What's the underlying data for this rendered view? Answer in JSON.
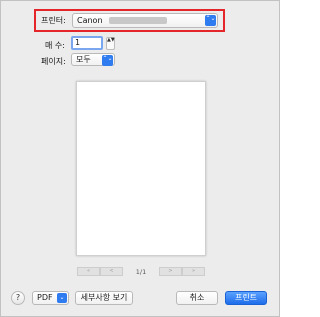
{
  "printer": {
    "label": "프린터:",
    "value": "Canon",
    "arrows_icon": "⌃⌄"
  },
  "copies": {
    "label": "매 수:",
    "value": "1",
    "stepper_icon": "▲▼"
  },
  "pages": {
    "label": "페이지:",
    "value": "모두",
    "arrows_icon": "⌃⌄"
  },
  "preview": {
    "first_icon": "«",
    "prev_icon": "<",
    "page_indicator": "1/1",
    "next_icon": ">",
    "last_icon": "»"
  },
  "footer": {
    "help_label": "?",
    "pdf_label": "PDF",
    "pdf_arrow": "⌄",
    "details_label": "세부사항 보기",
    "cancel_label": "취소",
    "print_label": "프린트"
  },
  "colors": {
    "highlight": "#e4262b",
    "accent": "#2f7bf0"
  }
}
